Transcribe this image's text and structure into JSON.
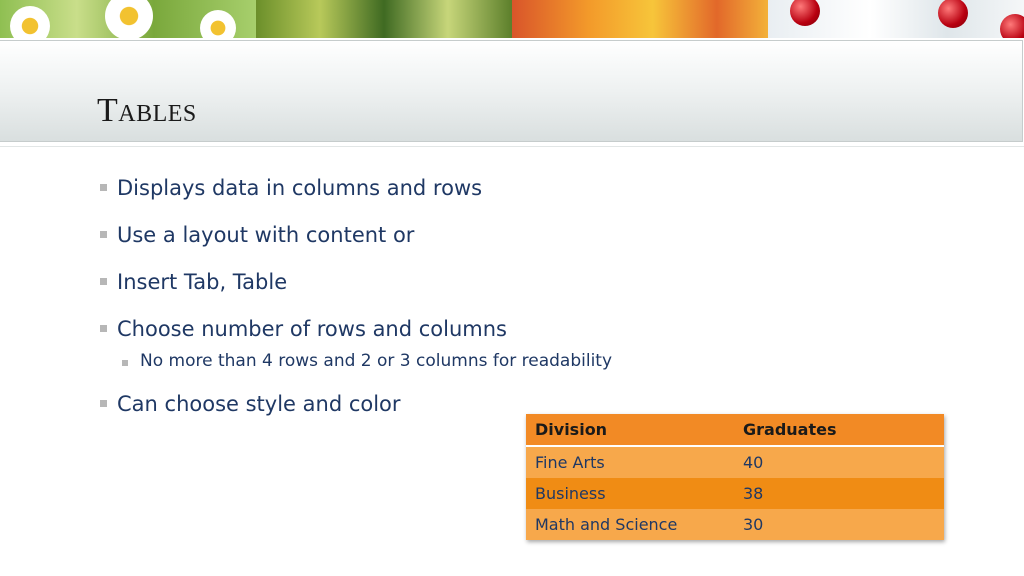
{
  "slide": {
    "title": "Tables"
  },
  "bullets": [
    {
      "level": 1,
      "text": "Displays data in columns and rows"
    },
    {
      "level": 1,
      "text": "Use a layout with content or"
    },
    {
      "level": 1,
      "text": "Insert Tab, Table"
    },
    {
      "level": 1,
      "text": "Choose number of rows and columns"
    },
    {
      "level": 2,
      "text": "No more than 4 rows and 2 or 3 columns for readability"
    },
    {
      "level": 1,
      "text": "Can choose style and color"
    }
  ],
  "table": {
    "headers": [
      "Division",
      "Graduates"
    ],
    "rows": [
      [
        "Fine Arts",
        "40"
      ],
      [
        "Business",
        "38"
      ],
      [
        "Math and Science",
        "30"
      ]
    ]
  },
  "colors": {
    "accent": "#f28a25",
    "text": "#1f3864",
    "bullet": "#b7b7b7"
  }
}
